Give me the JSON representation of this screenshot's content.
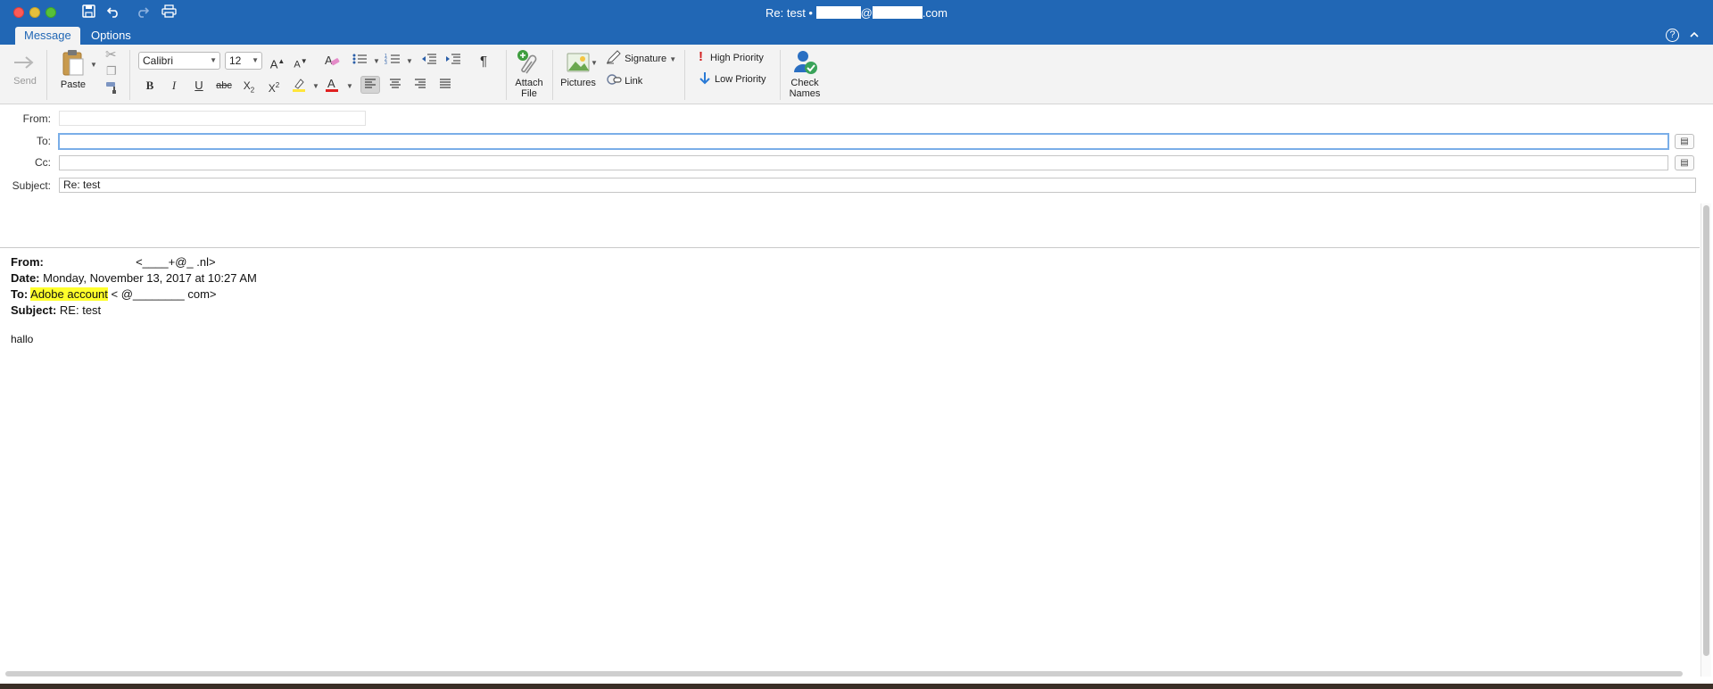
{
  "window": {
    "title_prefix": "Re: test •",
    "title_at": "@",
    "title_suffix": ".com"
  },
  "tabs": [
    "Message",
    "Options"
  ],
  "help_label": "?",
  "ribbon": {
    "send_label": "Send",
    "paste_label": "Paste",
    "font_name": "Calibri",
    "font_size": "12",
    "bold": "B",
    "italic": "I",
    "underline": "U",
    "strike": "abc",
    "pilcrow": "¶",
    "attach_label_1": "Attach",
    "attach_label_2": "File",
    "pictures_label": "Pictures",
    "signature_label": "Signature",
    "link_label": "Link",
    "high_priority_label": "High Priority",
    "low_priority_label": "Low Priority",
    "check_names_label_1": "Check",
    "check_names_label_2": "Names"
  },
  "header": {
    "from_label": "From:",
    "to_label": "To:",
    "cc_label": "Cc:",
    "subject_label": "Subject:",
    "from_value": "",
    "to_value": "",
    "cc_value": "",
    "subject_value": "Re: test"
  },
  "quoted": {
    "from_label": "From:",
    "from_value": "<____+@_        .nl>",
    "date_label": "Date:",
    "date_value": "Monday, November 13, 2017 at 10:27 AM",
    "to_label": "To:",
    "to_name": "Adobe account",
    "to_addr": "<              @________ com>",
    "subject_label": "Subject:",
    "subject_value": "RE: test",
    "body_text": "hallo"
  },
  "colors": {
    "titlebar": "#2167b5",
    "ribbon_bg": "#f3f3f3",
    "highlight": "#ffff2b",
    "high_priority": "#d32020",
    "low_priority": "#2a7ad5"
  }
}
